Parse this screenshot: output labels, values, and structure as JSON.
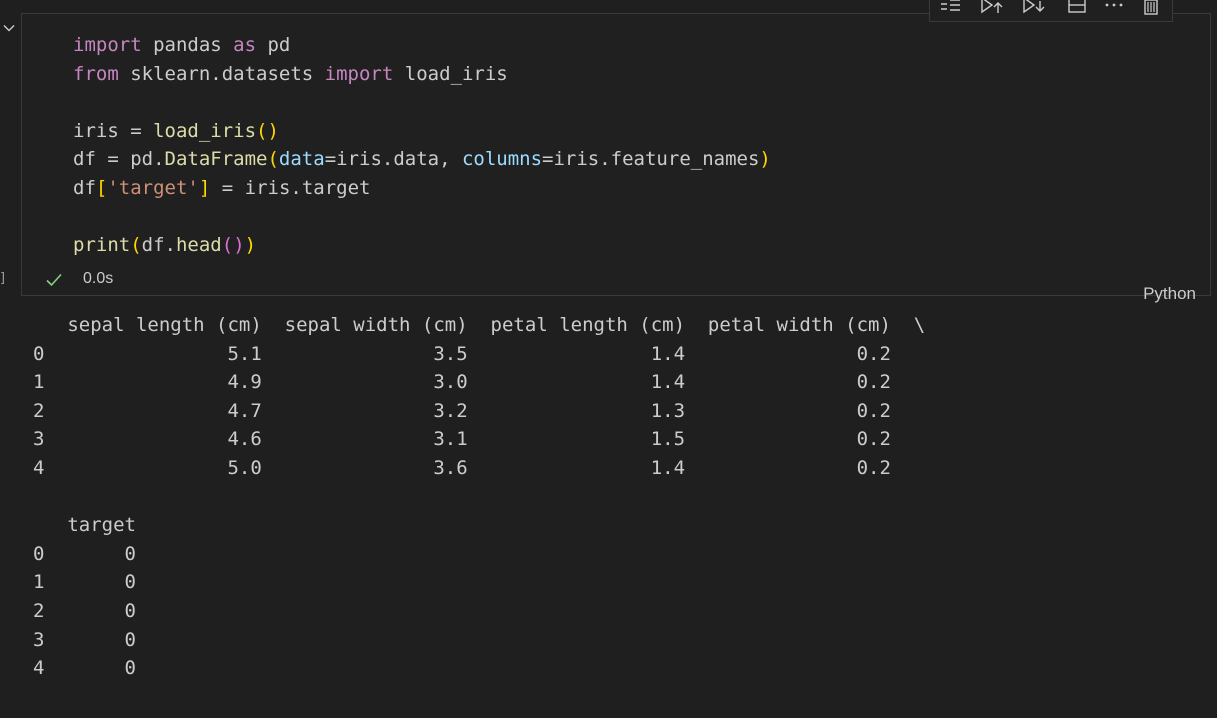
{
  "cell": {
    "code_lines": [
      [
        {
          "t": "import",
          "c": "kw"
        },
        {
          "t": " pandas "
        },
        {
          "t": "as",
          "c": "kw"
        },
        {
          "t": " pd"
        }
      ],
      [
        {
          "t": "from",
          "c": "kw"
        },
        {
          "t": " sklearn.datasets "
        },
        {
          "t": "import",
          "c": "kw"
        },
        {
          "t": " load_iris"
        }
      ],
      [],
      [
        {
          "t": "iris = "
        },
        {
          "t": "load_iris",
          "c": "fn"
        },
        {
          "t": "()",
          "c": "br1"
        }
      ],
      [
        {
          "t": "df = pd."
        },
        {
          "t": "DataFrame",
          "c": "fn"
        },
        {
          "t": "(",
          "c": "br1"
        },
        {
          "t": "data",
          "c": "param"
        },
        {
          "t": "=iris.data, "
        },
        {
          "t": "columns",
          "c": "param"
        },
        {
          "t": "=iris.feature_names"
        },
        {
          "t": ")",
          "c": "br1"
        }
      ],
      [
        {
          "t": "df"
        },
        {
          "t": "[",
          "c": "br1"
        },
        {
          "t": "'target'",
          "c": "str"
        },
        {
          "t": "]",
          "c": "br1"
        },
        {
          "t": " = iris.target"
        }
      ],
      [],
      [
        {
          "t": "print",
          "c": "fn"
        },
        {
          "t": "(",
          "c": "br1"
        },
        {
          "t": "df."
        },
        {
          "t": "head",
          "c": "fn"
        },
        {
          "t": "()",
          "c": "br2"
        },
        {
          "t": ")",
          "c": "br1"
        }
      ]
    ],
    "exec_time": "0.0s",
    "exec_bracket": "]",
    "language": "Python"
  },
  "toolbar": {
    "icons": [
      "run-by-line-icon",
      "execute-above-icon",
      "execute-below-icon",
      "split-cell-icon",
      "more-icon",
      "delete-icon"
    ]
  },
  "output": {
    "table1_header": "   sepal length (cm)  sepal width (cm)  petal length (cm)  petal width (cm)  \\",
    "table1_rows": [
      "0                5.1               3.5                1.4               0.2",
      "1                4.9               3.0                1.4               0.2",
      "2                4.7               3.2                1.3               0.2",
      "3                4.6               3.1                1.5               0.2",
      "4                5.0               3.6                1.4               0.2"
    ],
    "table2_header": "   target",
    "table2_rows": [
      "0       0",
      "1       0",
      "2       0",
      "3       0",
      "4       0"
    ]
  },
  "colors": {
    "background": "#1f1f1f",
    "keyword": "#c586c0",
    "function": "#dcdcaa",
    "parameter": "#9cdcfe",
    "string": "#ce9178",
    "bracket_level1": "#ffd700",
    "bracket_level2": "#da70d6",
    "success_check": "#89d185"
  }
}
